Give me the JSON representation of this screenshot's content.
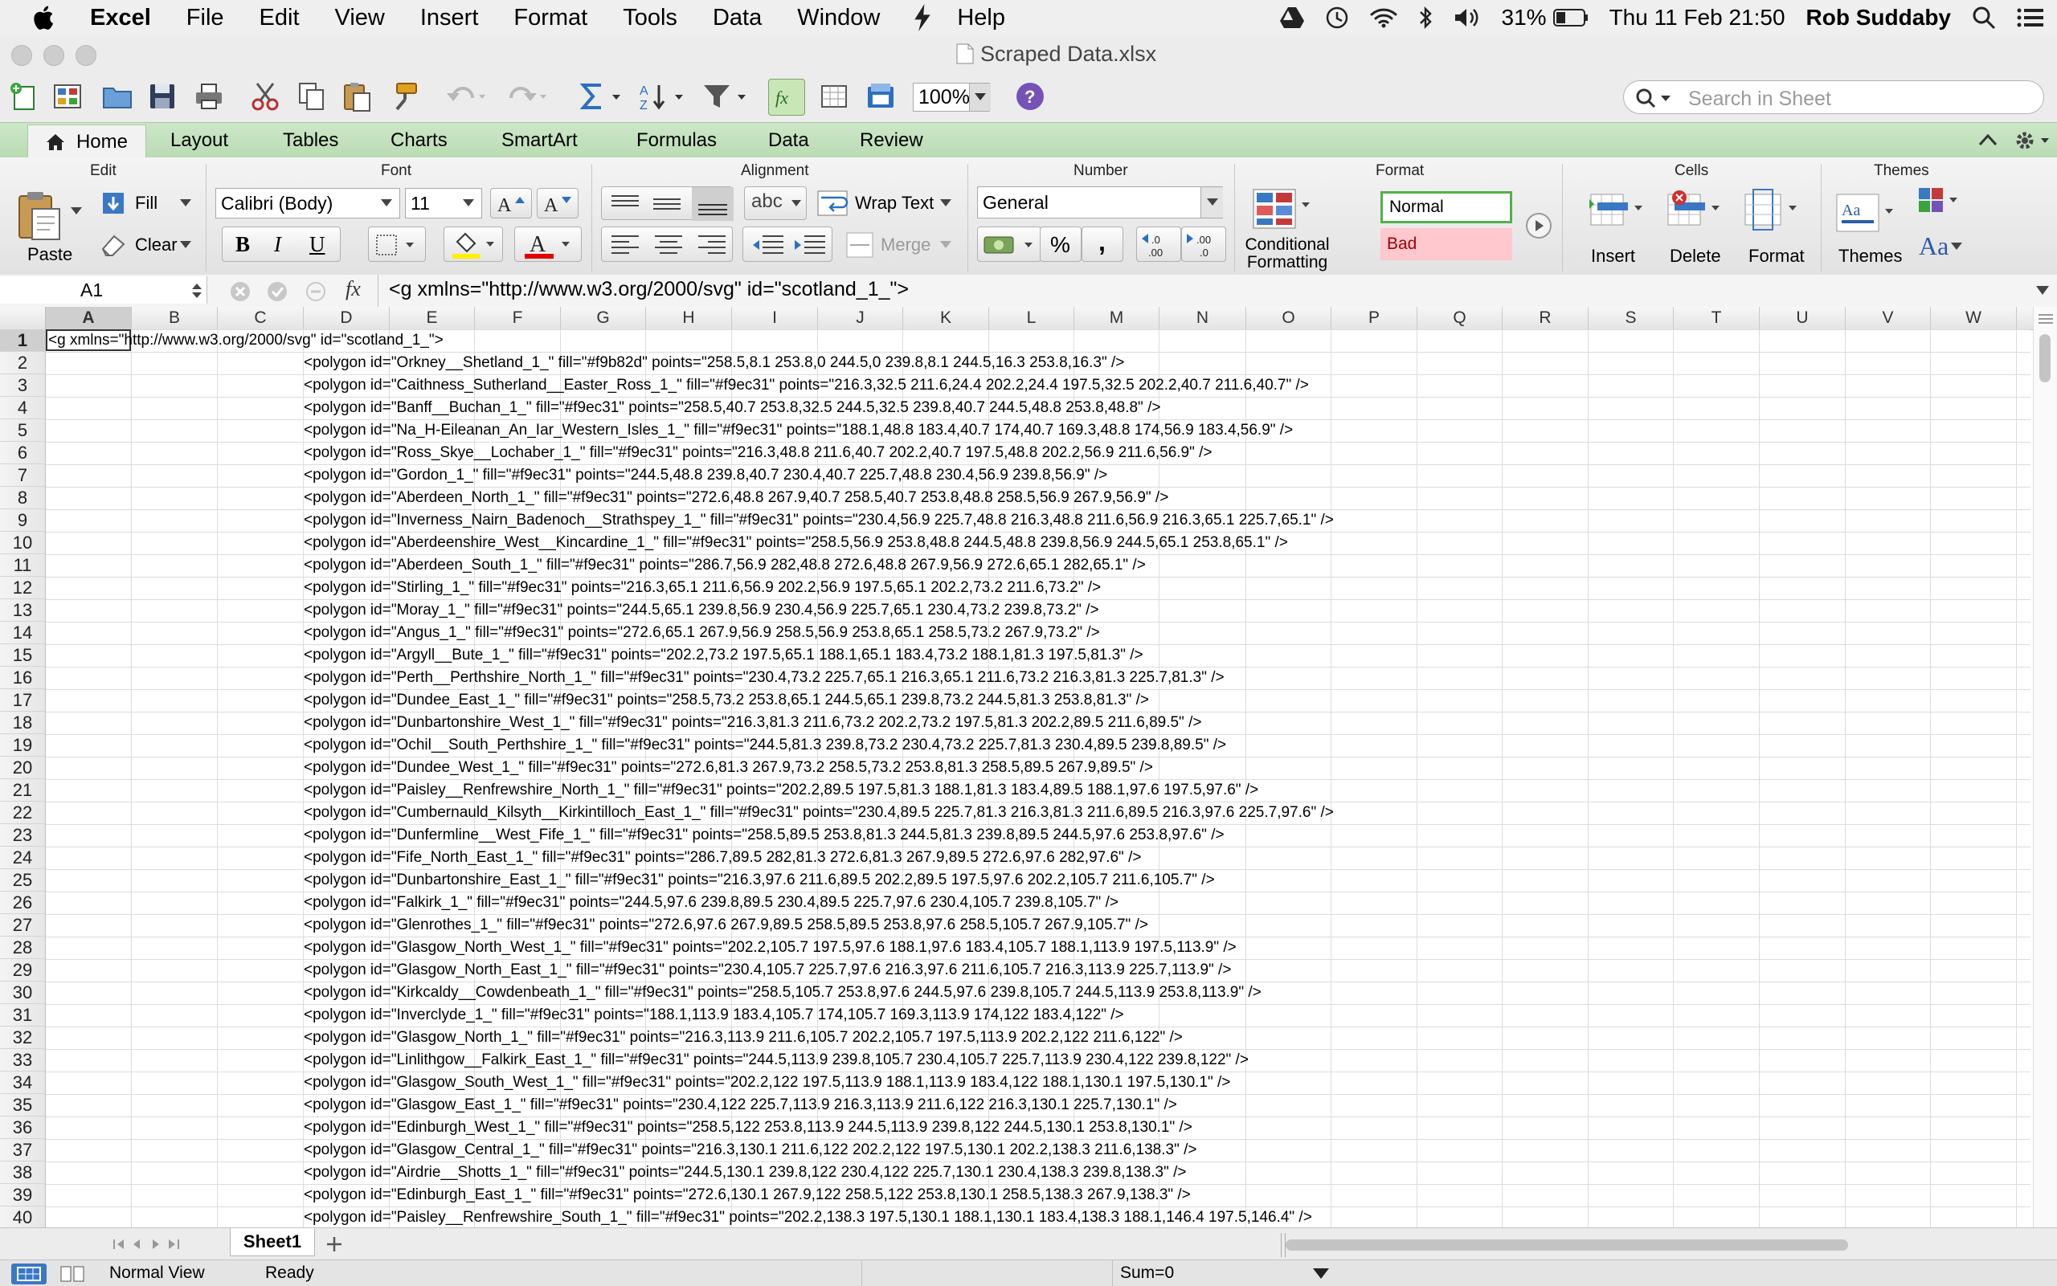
{
  "menubar": {
    "app": "Excel",
    "items": [
      "File",
      "Edit",
      "View",
      "Insert",
      "Format",
      "Tools",
      "Data",
      "Window",
      "Help"
    ],
    "battery": "31%",
    "datetime": "Thu 11 Feb  21:50",
    "user": "Rob Suddaby"
  },
  "window": {
    "title": "Scraped Data.xlsx"
  },
  "toolbar": {
    "zoom": "100%",
    "search_placeholder": "Search in Sheet"
  },
  "ribbon_tabs": [
    "Home",
    "Layout",
    "Tables",
    "Charts",
    "SmartArt",
    "Formulas",
    "Data",
    "Review"
  ],
  "ribbon": {
    "edit": {
      "group": "Edit",
      "paste": "Paste",
      "fill": "Fill",
      "clear": "Clear"
    },
    "font": {
      "group": "Font",
      "name": "Calibri (Body)",
      "size": "11"
    },
    "alignment": {
      "group": "Alignment",
      "wrap": "Wrap Text",
      "merge": "Merge",
      "orient": "abc"
    },
    "number": {
      "group": "Number",
      "format": "General",
      "percent": "%",
      "comma": ","
    },
    "format": {
      "group": "Format",
      "conditional": "Conditional Formatting",
      "normal": "Normal",
      "bad": "Bad"
    },
    "cells": {
      "group": "Cells",
      "insert": "Insert",
      "delete": "Delete",
      "format": "Format"
    },
    "themes": {
      "group": "Themes",
      "themes": "Themes",
      "fontsym": "Aa"
    }
  },
  "formula_bar": {
    "name_box": "A1",
    "fx": "fx",
    "content": "<g xmlns=\"http://www.w3.org/2000/svg\" id=\"scotland_1_\">"
  },
  "columns": [
    "A",
    "B",
    "C",
    "D",
    "E",
    "F",
    "G",
    "H",
    "I",
    "J",
    "K",
    "L",
    "M",
    "N",
    "O",
    "P",
    "Q",
    "R",
    "S",
    "T",
    "U",
    "V",
    "W"
  ],
  "rows": [
    "<g xmlns=\"http://www.w3.org/2000/svg\" id=\"scotland_1_\">",
    "<polygon id=\"Orkney__Shetland_1_\" fill=\"#f9b82d\" points=\"258.5,8.1 253.8,0 244.5,0 239.8,8.1 244.5,16.3 253.8,16.3\" />",
    "<polygon id=\"Caithness_Sutherland__Easter_Ross_1_\" fill=\"#f9ec31\" points=\"216.3,32.5 211.6,24.4 202.2,24.4 197.5,32.5 202.2,40.7 211.6,40.7\" />",
    "<polygon id=\"Banff__Buchan_1_\" fill=\"#f9ec31\" points=\"258.5,40.7 253.8,32.5 244.5,32.5 239.8,40.7 244.5,48.8 253.8,48.8\" />",
    "<polygon id=\"Na_H-Eileanan_An_Iar_Western_Isles_1_\" fill=\"#f9ec31\" points=\"188.1,48.8 183.4,40.7 174,40.7 169.3,48.8 174,56.9 183.4,56.9\" />",
    "<polygon id=\"Ross_Skye__Lochaber_1_\" fill=\"#f9ec31\" points=\"216.3,48.8 211.6,40.7 202.2,40.7 197.5,48.8 202.2,56.9 211.6,56.9\" />",
    "<polygon id=\"Gordon_1_\" fill=\"#f9ec31\" points=\"244.5,48.8 239.8,40.7 230.4,40.7 225.7,48.8 230.4,56.9 239.8,56.9\" />",
    "<polygon id=\"Aberdeen_North_1_\" fill=\"#f9ec31\" points=\"272.6,48.8 267.9,40.7 258.5,40.7 253.8,48.8 258.5,56.9 267.9,56.9\" />",
    "<polygon id=\"Inverness_Nairn_Badenoch__Strathspey_1_\" fill=\"#f9ec31\" points=\"230.4,56.9 225.7,48.8 216.3,48.8 211.6,56.9 216.3,65.1 225.7,65.1\" />",
    "<polygon id=\"Aberdeenshire_West__Kincardine_1_\" fill=\"#f9ec31\" points=\"258.5,56.9 253.8,48.8 244.5,48.8 239.8,56.9 244.5,65.1 253.8,65.1\" />",
    "<polygon id=\"Aberdeen_South_1_\" fill=\"#f9ec31\" points=\"286.7,56.9 282,48.8 272.6,48.8 267.9,56.9 272.6,65.1 282,65.1\" />",
    "<polygon id=\"Stirling_1_\" fill=\"#f9ec31\" points=\"216.3,65.1 211.6,56.9 202.2,56.9 197.5,65.1 202.2,73.2 211.6,73.2\" />",
    "<polygon id=\"Moray_1_\" fill=\"#f9ec31\" points=\"244.5,65.1 239.8,56.9 230.4,56.9 225.7,65.1 230.4,73.2 239.8,73.2\" />",
    "<polygon id=\"Angus_1_\" fill=\"#f9ec31\" points=\"272.6,65.1 267.9,56.9 258.5,56.9 253.8,65.1 258.5,73.2 267.9,73.2\" />",
    "<polygon id=\"Argyll__Bute_1_\" fill=\"#f9ec31\" points=\"202.2,73.2 197.5,65.1 188.1,65.1 183.4,73.2 188.1,81.3 197.5,81.3\" />",
    "<polygon id=\"Perth__Perthshire_North_1_\" fill=\"#f9ec31\" points=\"230.4,73.2 225.7,65.1 216.3,65.1 211.6,73.2 216.3,81.3 225.7,81.3\" />",
    "<polygon id=\"Dundee_East_1_\" fill=\"#f9ec31\" points=\"258.5,73.2 253.8,65.1 244.5,65.1 239.8,73.2 244.5,81.3 253.8,81.3\" />",
    "<polygon id=\"Dunbartonshire_West_1_\" fill=\"#f9ec31\" points=\"216.3,81.3 211.6,73.2 202.2,73.2 197.5,81.3 202.2,89.5 211.6,89.5\" />",
    "<polygon id=\"Ochil__South_Perthshire_1_\" fill=\"#f9ec31\" points=\"244.5,81.3 239.8,73.2 230.4,73.2 225.7,81.3 230.4,89.5 239.8,89.5\" />",
    "<polygon id=\"Dundee_West_1_\" fill=\"#f9ec31\" points=\"272.6,81.3 267.9,73.2 258.5,73.2 253.8,81.3 258.5,89.5 267.9,89.5\" />",
    "<polygon id=\"Paisley__Renfrewshire_North_1_\" fill=\"#f9ec31\" points=\"202.2,89.5 197.5,81.3 188.1,81.3 183.4,89.5 188.1,97.6 197.5,97.6\" />",
    "<polygon id=\"Cumbernauld_Kilsyth__Kirkintilloch_East_1_\" fill=\"#f9ec31\" points=\"230.4,89.5 225.7,81.3 216.3,81.3 211.6,89.5 216.3,97.6 225.7,97.6\" />",
    "<polygon id=\"Dunfermline__West_Fife_1_\" fill=\"#f9ec31\" points=\"258.5,89.5 253.8,81.3 244.5,81.3 239.8,89.5 244.5,97.6 253.8,97.6\" />",
    "<polygon id=\"Fife_North_East_1_\" fill=\"#f9ec31\" points=\"286.7,89.5 282,81.3 272.6,81.3 267.9,89.5 272.6,97.6 282,97.6\" />",
    "<polygon id=\"Dunbartonshire_East_1_\" fill=\"#f9ec31\" points=\"216.3,97.6 211.6,89.5 202.2,89.5 197.5,97.6 202.2,105.7 211.6,105.7\" />",
    "<polygon id=\"Falkirk_1_\" fill=\"#f9ec31\" points=\"244.5,97.6 239.8,89.5 230.4,89.5 225.7,97.6 230.4,105.7 239.8,105.7\" />",
    "<polygon id=\"Glenrothes_1_\" fill=\"#f9ec31\" points=\"272.6,97.6 267.9,89.5 258.5,89.5 253.8,97.6 258.5,105.7 267.9,105.7\" />",
    "<polygon id=\"Glasgow_North_West_1_\" fill=\"#f9ec31\" points=\"202.2,105.7 197.5,97.6 188.1,97.6 183.4,105.7 188.1,113.9 197.5,113.9\" />",
    "<polygon id=\"Glasgow_North_East_1_\" fill=\"#f9ec31\" points=\"230.4,105.7 225.7,97.6 216.3,97.6 211.6,105.7 216.3,113.9 225.7,113.9\" />",
    "<polygon id=\"Kirkcaldy__Cowdenbeath_1_\" fill=\"#f9ec31\" points=\"258.5,105.7 253.8,97.6 244.5,97.6 239.8,105.7 244.5,113.9 253.8,113.9\" />",
    "<polygon id=\"Inverclyde_1_\" fill=\"#f9ec31\" points=\"188.1,113.9 183.4,105.7 174,105.7 169.3,113.9 174,122 183.4,122\" />",
    "<polygon id=\"Glasgow_North_1_\" fill=\"#f9ec31\" points=\"216.3,113.9 211.6,105.7 202.2,105.7 197.5,113.9 202.2,122 211.6,122\" />",
    "<polygon id=\"Linlithgow__Falkirk_East_1_\" fill=\"#f9ec31\" points=\"244.5,113.9 239.8,105.7 230.4,105.7 225.7,113.9 230.4,122 239.8,122\" />",
    "<polygon id=\"Glasgow_South_West_1_\" fill=\"#f9ec31\" points=\"202.2,122 197.5,113.9 188.1,113.9 183.4,122 188.1,130.1 197.5,130.1\" />",
    "<polygon id=\"Glasgow_East_1_\" fill=\"#f9ec31\" points=\"230.4,122 225.7,113.9 216.3,113.9 211.6,122 216.3,130.1 225.7,130.1\" />",
    "<polygon id=\"Edinburgh_West_1_\" fill=\"#f9ec31\" points=\"258.5,122 253.8,113.9 244.5,113.9 239.8,122 244.5,130.1 253.8,130.1\" />",
    "<polygon id=\"Glasgow_Central_1_\" fill=\"#f9ec31\" points=\"216.3,130.1 211.6,122 202.2,122 197.5,130.1 202.2,138.3 211.6,138.3\" />",
    "<polygon id=\"Airdrie__Shotts_1_\" fill=\"#f9ec31\" points=\"244.5,130.1 239.8,122 230.4,122 225.7,130.1 230.4,138.3 239.8,138.3\" />",
    "<polygon id=\"Edinburgh_East_1_\" fill=\"#f9ec31\" points=\"272.6,130.1 267.9,122 258.5,122 253.8,130.1 258.5,138.3 267.9,138.3\" />",
    "<polygon id=\"Paisley__Renfrewshire_South_1_\" fill=\"#f9ec31\" points=\"202.2,138.3 197.5,130.1 188.1,130.1 183.4,138.3 188.1,146.4 197.5,146.4\" />"
  ],
  "sheet_tabs": [
    "Sheet1"
  ],
  "status": {
    "view": "Normal View",
    "state": "Ready",
    "sum": "Sum=0"
  },
  "colors": {
    "ribbon_tab_bg": "#c4e1be",
    "normal_style_border": "#53b04b",
    "bad_style_bg": "#ffc7ce",
    "bad_style_text": "#9c0006"
  }
}
